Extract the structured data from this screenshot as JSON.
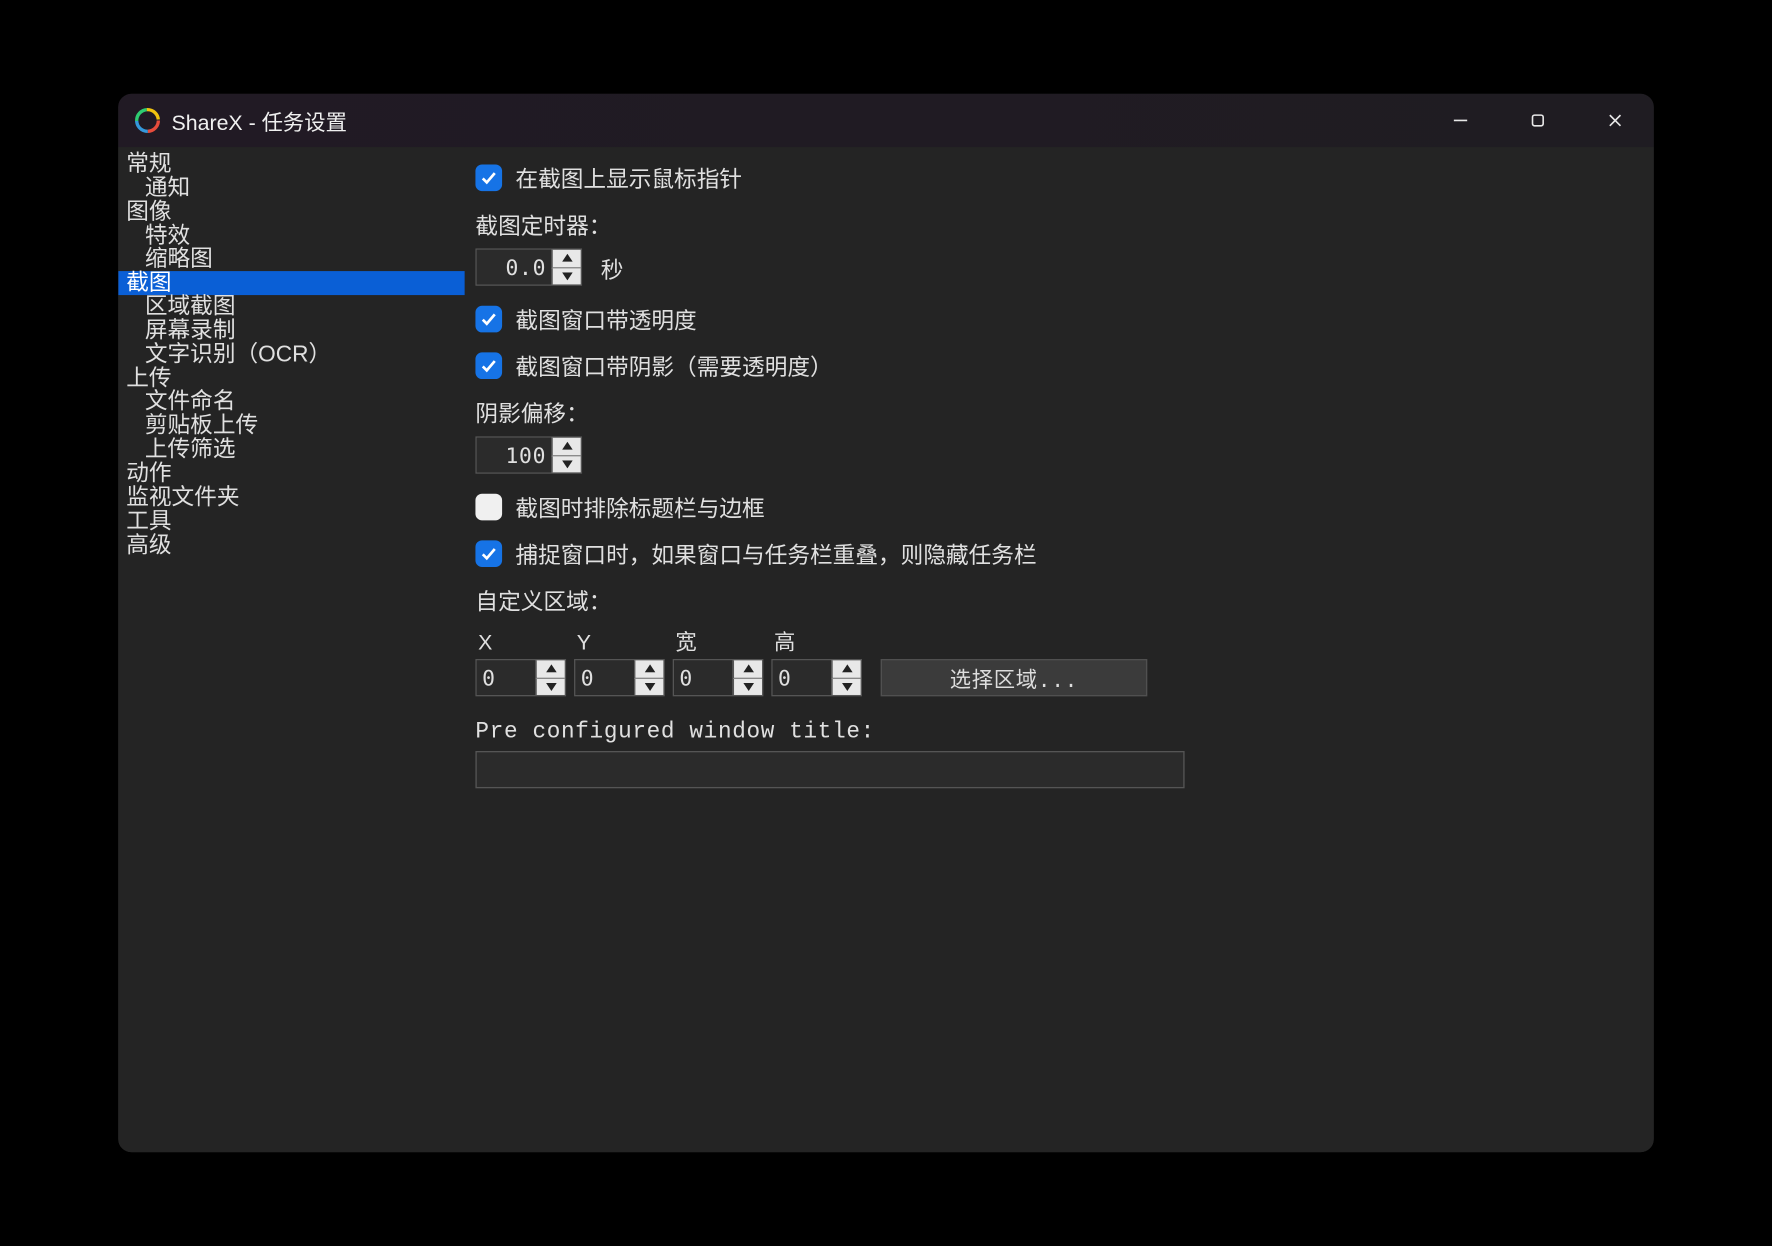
{
  "window": {
    "title": "ShareX - 任务设置"
  },
  "sidebar": {
    "items": [
      {
        "label": "常规",
        "indent": 0
      },
      {
        "label": "通知",
        "indent": 1
      },
      {
        "label": "图像",
        "indent": 0
      },
      {
        "label": "特效",
        "indent": 1
      },
      {
        "label": "缩略图",
        "indent": 1
      },
      {
        "label": "截图",
        "indent": 0,
        "selected": true
      },
      {
        "label": "区域截图",
        "indent": 1
      },
      {
        "label": "屏幕录制",
        "indent": 1
      },
      {
        "label": "文字识别（OCR）",
        "indent": 1
      },
      {
        "label": "上传",
        "indent": 0
      },
      {
        "label": "文件命名",
        "indent": 1
      },
      {
        "label": "剪贴板上传",
        "indent": 1
      },
      {
        "label": "上传筛选",
        "indent": 1
      },
      {
        "label": "动作",
        "indent": 0
      },
      {
        "label": "监视文件夹",
        "indent": 0
      },
      {
        "label": "工具",
        "indent": 0
      },
      {
        "label": "高级",
        "indent": 0
      }
    ]
  },
  "content": {
    "showCursor": {
      "checked": true,
      "label": "在截图上显示鼠标指针"
    },
    "timerLabel": "截图定时器：",
    "timerValue": "0.0",
    "timerUnit": "秒",
    "transparency": {
      "checked": true,
      "label": "截图窗口带透明度"
    },
    "shadow": {
      "checked": true,
      "label": "截图窗口带阴影（需要透明度）"
    },
    "shadowOffsetLabel": "阴影偏移：",
    "shadowOffsetValue": "100",
    "excludeTitlebar": {
      "checked": false,
      "label": "截图时排除标题栏与边框"
    },
    "hideTaskbar": {
      "checked": true,
      "label": "捕捉窗口时，如果窗口与任务栏重叠，则隐藏任务栏"
    },
    "customRegionLabel": "自定义区域：",
    "coords": {
      "x": {
        "label": "X",
        "value": "0"
      },
      "y": {
        "label": "Y",
        "value": "0"
      },
      "w": {
        "label": "宽",
        "value": "0"
      },
      "h": {
        "label": "高",
        "value": "0"
      }
    },
    "selectRegionBtn": "选择区域...",
    "preConfigLabel": "Pre configured window title:",
    "preConfigValue": ""
  }
}
